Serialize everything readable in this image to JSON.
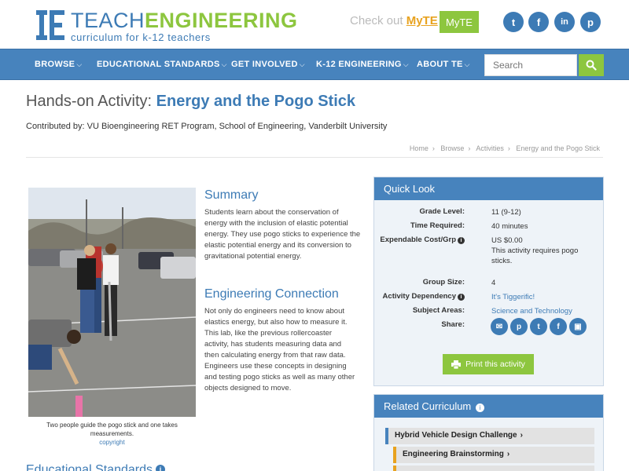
{
  "colors": {
    "brand_blue": "#3d7bb5",
    "brand_green": "#8dc63f",
    "nav_bg": "#4783bd",
    "myte_orange": "#e8a21f"
  },
  "header": {
    "logo_teach": "TEACH",
    "logo_engineering": "ENGINEERING",
    "logo_tagline": "curriculum for k-12 teachers",
    "checkout_text": "Check out",
    "checkout_myte": "MyTE",
    "myte_button": "MyTE",
    "social": [
      {
        "name": "twitter-icon",
        "glyph": "t"
      },
      {
        "name": "facebook-icon",
        "glyph": "f"
      },
      {
        "name": "linkedin-icon",
        "glyph": "in"
      },
      {
        "name": "pinterest-icon",
        "glyph": "p"
      }
    ]
  },
  "nav": {
    "items": [
      "BROWSE",
      "EDUCATIONAL STANDARDS",
      "GET INVOLVED",
      "K-12 ENGINEERING",
      "ABOUT TE"
    ],
    "search_placeholder": "Search"
  },
  "page": {
    "title_prefix": "Hands-on Activity:",
    "title_name": "Energy and the Pogo Stick",
    "contributed": "Contributed by: VU Bioengineering RET Program, School of Engineering, Vanderbilt University",
    "breadcrumb": [
      "Home",
      "Browse",
      "Activities",
      "Energy and the Pogo Stick"
    ]
  },
  "photo": {
    "caption": "Two people guide the pogo stick and one takes measurements.",
    "link": "copyright"
  },
  "summary": {
    "heading": "Summary",
    "text": "Students learn about the conservation of energy with the inclusion of elastic potential energy. They use pogo sticks to experience the elastic potential energy and its conversion to gravitational potential energy."
  },
  "engineering_connection": {
    "heading": "Engineering Connection",
    "text": "Not only do engineers need to know about elastics energy, but also how to measure it. This lab, like the previous rollercoaster activity, has students measuring data and then calculating energy from that raw data. Engineers use these concepts in designing and testing pogo sticks as well as many other objects designed to move."
  },
  "educational_standards": {
    "heading": "Educational Standards",
    "icon": "i"
  },
  "quick_look": {
    "heading": "Quick Look",
    "grade_level_label": "Grade Level:",
    "grade_level": "11 (9-12)",
    "time_label": "Time Required:",
    "time": "40 minutes",
    "cost_label": "Expendable Cost/Grp",
    "cost": "US $0.00",
    "cost_note": "This activity requires pogo sticks.",
    "group_label": "Group Size:",
    "group": "4",
    "dependency_label": "Activity Dependency",
    "dependency": "It's Tiggerific!",
    "subject_label": "Subject Areas:",
    "subject": "Science and Technology",
    "share_label": "Share:",
    "share_icons": [
      {
        "name": "email-icon",
        "glyph": "✉"
      },
      {
        "name": "pinterest-icon",
        "glyph": "p"
      },
      {
        "name": "twitter-icon",
        "glyph": "t"
      },
      {
        "name": "facebook-icon",
        "glyph": "f"
      },
      {
        "name": "google-classroom-icon",
        "glyph": "▣"
      }
    ],
    "print_button": "Print this activity"
  },
  "related_curriculum": {
    "heading": "Related Curriculum",
    "items": [
      "Hybrid Vehicle Design Challenge",
      "Engineering Brainstorming"
    ]
  }
}
